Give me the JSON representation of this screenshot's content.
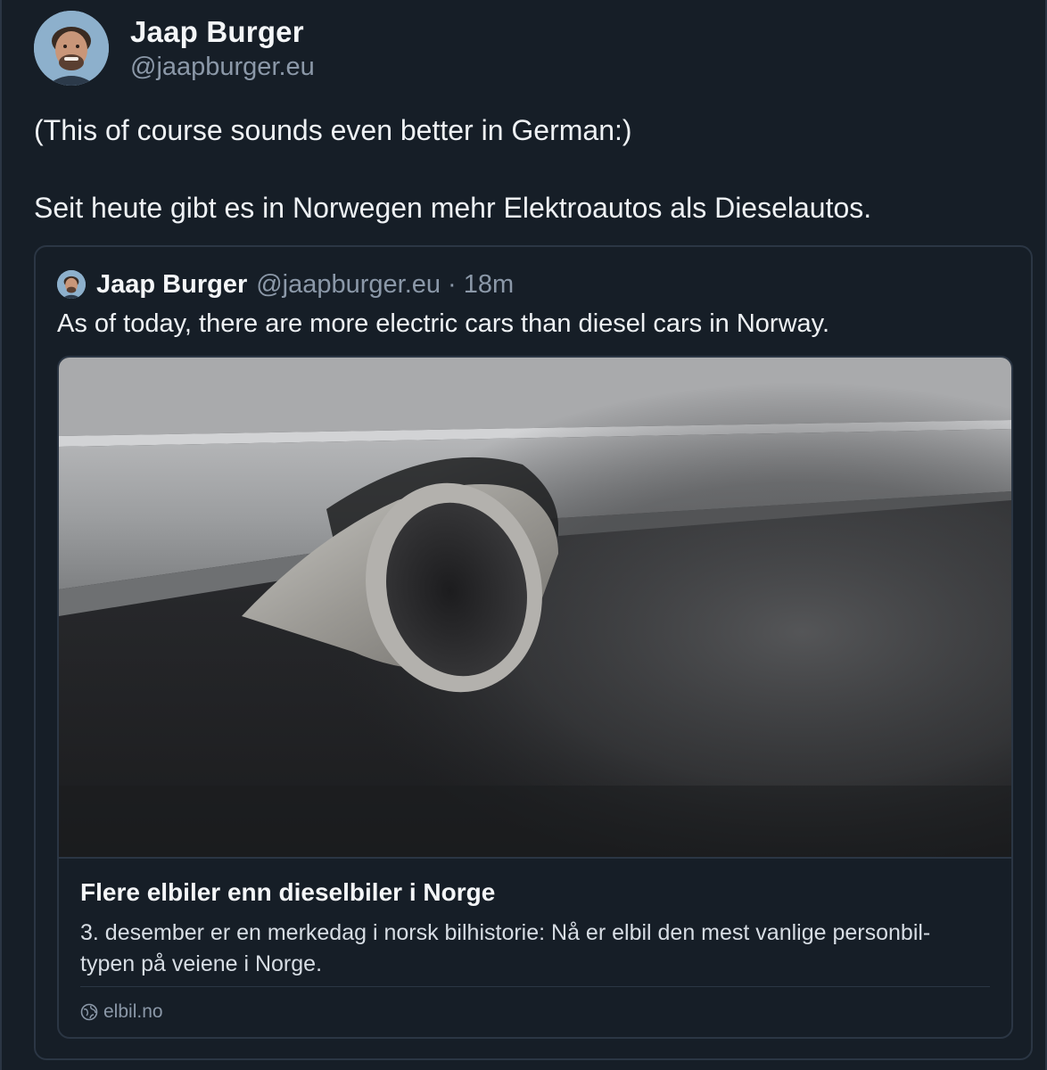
{
  "post": {
    "author": {
      "display_name": "Jaap Burger",
      "handle": "@jaapburger.eu"
    },
    "text_lines": [
      "(This of course sounds even better in German:)",
      "Seit heute gibt es in Norwegen mehr Elektroautos als Dieselautos."
    ]
  },
  "quoted_post": {
    "author": {
      "display_name": "Jaap Burger",
      "handle": "@jaapburger.eu"
    },
    "separator": "·",
    "time": "18m",
    "text": "As of today, there are more electric cars than diesel cars in Norway.",
    "link_card": {
      "image_icon": "exhaust-pipe-photo",
      "title": "Flere elbiler enn dieselbiler i Norge",
      "description": "3. desember er en merkedag i norsk bilhistorie: Nå er elbil den mest vanlige personbil-typen på veiene i Norge.",
      "domain": "elbil.no",
      "domain_icon": "globe-icon"
    }
  },
  "colors": {
    "background": "#161e27",
    "border": "#2b3644",
    "text_primary": "#f1f3f5",
    "text_secondary": "#8b98a8"
  }
}
